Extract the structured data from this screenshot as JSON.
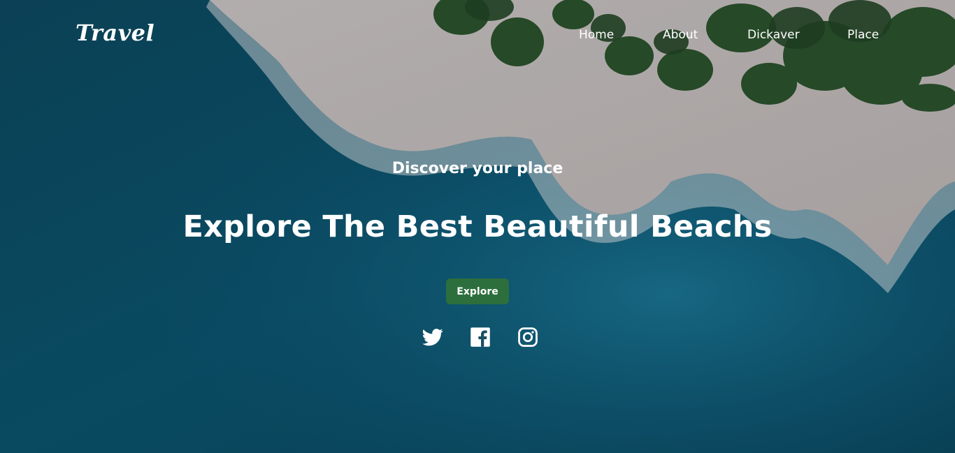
{
  "header": {
    "logo": "Travel",
    "nav": [
      "Home",
      "About",
      "Dickaver",
      "Place"
    ]
  },
  "hero": {
    "subtitle": "Discover your place",
    "title": "Explore The Best Beautiful Beachs",
    "cta_label": "Explore",
    "background": "aerial-beach-photo"
  },
  "social": {
    "icons": [
      "twitter-icon",
      "facebook-icon",
      "instagram-icon"
    ]
  },
  "colors": {
    "button": "#2d6f3c",
    "text": "#ffffff",
    "ocean": "#0d4f66"
  }
}
